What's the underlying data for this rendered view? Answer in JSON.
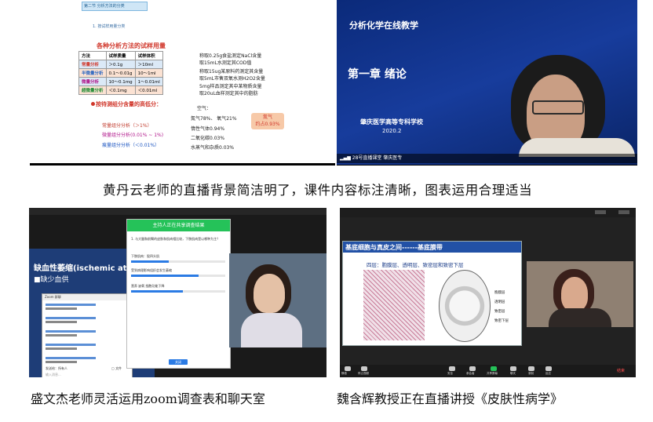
{
  "top_left": {
    "header_label": "第二节 分析方法的分类",
    "sub_label": "1. 按试样用量分类",
    "table_title": "各种分析方法的试样用量",
    "headers": [
      "方法",
      "试样质量",
      "试样体积"
    ],
    "rows": [
      {
        "method": "常量分析",
        "mass": "＞0.1g",
        "volume": "＞10ml"
      },
      {
        "method": "半微量分析",
        "mass": "0.1～0.01g",
        "volume": "10～1ml"
      },
      {
        "method": "微量分析",
        "mass": "10～0.1mg",
        "volume": "1～0.01ml"
      },
      {
        "method": "超微量分析",
        "mass": "＜0.1mg",
        "volume": "＜0.01ml"
      }
    ],
    "examples": [
      "称取0.25g食盐测定NaCl含量",
      "取15mL水测定其COD值",
      "称取15ug某原料药测定其含量",
      "取5mL市售双氧水测H2O2含量",
      "5mg样品测定其中某物质含量",
      "取20uL血样测定其中的脂肪"
    ],
    "section2_title": "按待测组分含量的高低分：",
    "content_items": [
      {
        "label": "常量组分分析（＞1%）",
        "color": "#c0392b"
      },
      {
        "label": "微量组分分析(0.01% ~ 1%)",
        "color": "#b0158a"
      },
      {
        "label": "痕量组分分析（＜0.01%）",
        "color": "#1b55c1"
      }
    ],
    "air_title": "空气：",
    "air_lines": [
      "氮气78%、 氧气21%",
      "惰性气体0.94%",
      "二氧化碳0.03%",
      "水蒸气和杂质0.03%"
    ],
    "nitrogen_badge": [
      "氮气",
      "约占0.93%"
    ]
  },
  "top_right": {
    "course_title": "分析化学在线教学",
    "chapter": "第一章 绪论",
    "school": "肇庆医学高等专科学校",
    "year": "2020.2",
    "status": "28号直播课堂 肇庆医专"
  },
  "caption_top": "黄丹云老师的直播背景简洁明了，课件内容标注清晰，图表运用合理适当",
  "bottom_left": {
    "slide_title": "缺血性萎缩(ischemic atro",
    "slide_bullet": "缺少血供",
    "poll_title": "主持人正在共享调查结果",
    "poll_q": "1. 与大腿和前臂的皮肤和肌肉相比较，下肢肌肉是以哪种为主？",
    "poll_a1": "下肢肌肉：股四头肌",
    "poll_a2": "受到病理影响组织会发生萎缩",
    "poll_a3": "营养 缺氧 细胞功能下降",
    "poll_close": "关闭",
    "chat_title": "Zoom 群聊",
    "chat_to": "发送给：所有人",
    "chat_file": "文件",
    "chat_placeholder": "输入消息..."
  },
  "caption_bottom_left": "盛文杰老师灵活运用zoom调查表和聊天室",
  "bottom_right": {
    "slide_title": "基底细胞与真皮之间------基底膜带",
    "slide_sub": "四层：胞膜层、透明层、致密层和致密下层",
    "labels": [
      "胞膜层",
      "透明层",
      "致密层",
      "致密下层"
    ],
    "toolbar": [
      "静音",
      "停止视频",
      "安全",
      "参会者",
      "共享屏幕",
      "聊天",
      "录制",
      "反应",
      "结束"
    ]
  },
  "caption_bottom_right": "魏含辉教授正在直播讲授《皮肤性病学》"
}
